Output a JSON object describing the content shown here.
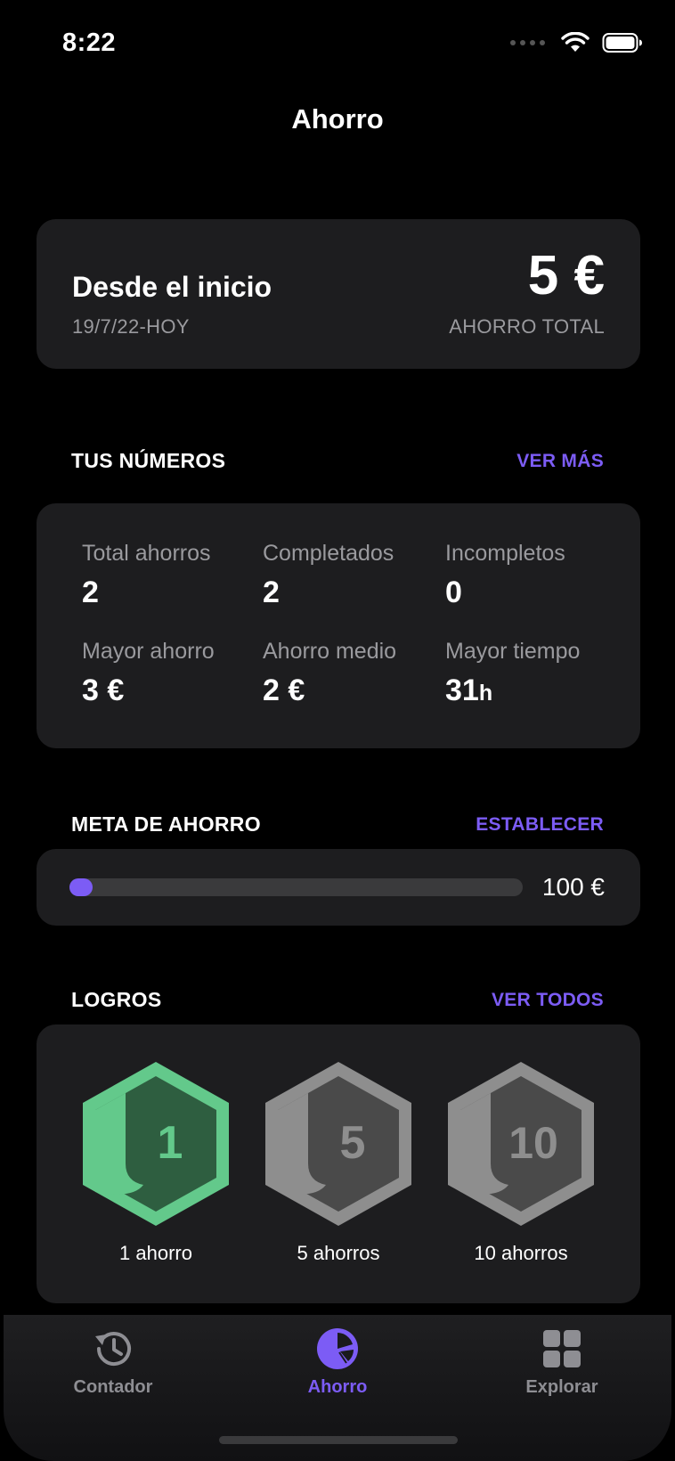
{
  "status_bar": {
    "time": "8:22"
  },
  "header": {
    "title": "Ahorro"
  },
  "summary": {
    "title": "Desde el inicio",
    "date_range": "19/7/22-HOY",
    "amount": "5 €",
    "caption": "AHORRO TOTAL"
  },
  "numbers": {
    "title": "TUS NÚMEROS",
    "action": "VER MÁS",
    "stats": [
      {
        "label": "Total ahorros",
        "value": "2",
        "unit": ""
      },
      {
        "label": "Completados",
        "value": "2",
        "unit": ""
      },
      {
        "label": "Incompletos",
        "value": "0",
        "unit": ""
      },
      {
        "label": "Mayor ahorro",
        "value": "3 €",
        "unit": ""
      },
      {
        "label": "Ahorro medio",
        "value": "2 €",
        "unit": ""
      },
      {
        "label": "Mayor tiempo",
        "value": "31",
        "unit": "h"
      }
    ]
  },
  "goal": {
    "title": "META DE AHORRO",
    "action": "ESTABLECER",
    "amount": "100 €",
    "progress": 0.05
  },
  "achievements": {
    "title": "LOGROS",
    "action": "VER TODOS",
    "badges": [
      {
        "number": "1",
        "label": "1 ahorro",
        "state": "unlocked"
      },
      {
        "number": "5",
        "label": "5 ahorros",
        "state": "locked"
      },
      {
        "number": "10",
        "label": "10 ahorros",
        "state": "locked"
      }
    ]
  },
  "tab_bar": {
    "tabs": [
      {
        "label": "Contador",
        "icon": "history-clock-icon",
        "active": false
      },
      {
        "label": "Ahorro",
        "icon": "pie-chart-icon",
        "active": true
      },
      {
        "label": "Explorar",
        "icon": "grid-icon",
        "active": false
      }
    ]
  },
  "colors": {
    "accent": "#7c5cf5",
    "card": "#1d1d1f",
    "badge_unlocked": "#63c98b",
    "badge_unlocked_inner": "#2e5e40",
    "badge_locked": "#8e8e8e",
    "badge_locked_inner": "#4a4a4a"
  }
}
